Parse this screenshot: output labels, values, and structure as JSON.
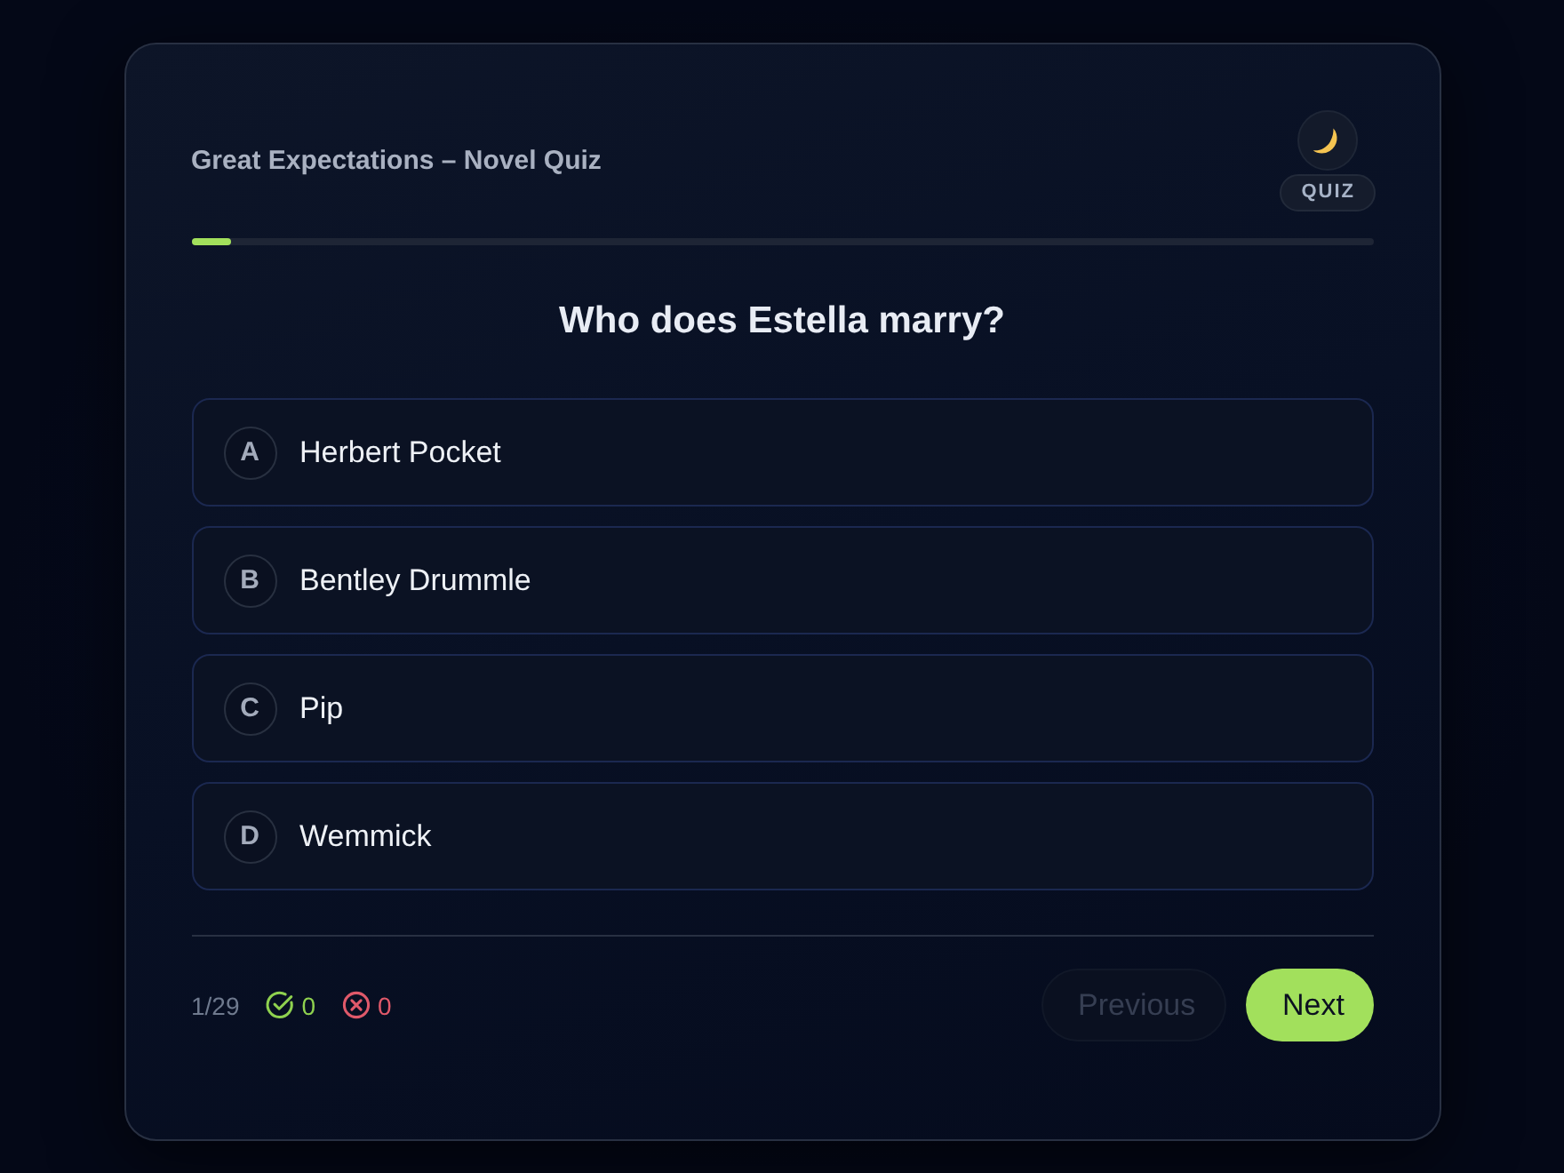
{
  "header": {
    "title": "Great Expectations – Novel Quiz",
    "badge": "QUIZ"
  },
  "progress": {
    "level": 0.0345
  },
  "question": "Who does Estella marry?",
  "options": [
    {
      "letter": "A",
      "text": "Herbert Pocket",
      "selected": false
    },
    {
      "letter": "B",
      "text": "Bentley Drummle",
      "selected": false
    },
    {
      "letter": "C",
      "text": "Pip",
      "selected": false
    },
    {
      "letter": "D",
      "text": "Wemmick",
      "selected": false
    }
  ],
  "footer": {
    "counter": "1/29",
    "correct": "0",
    "wrong": "0"
  },
  "buttons": [
    {
      "label": "Previous",
      "kind": "secondary",
      "disabled": true
    },
    {
      "label": "Next",
      "kind": "primary",
      "disabled": false
    }
  ]
}
